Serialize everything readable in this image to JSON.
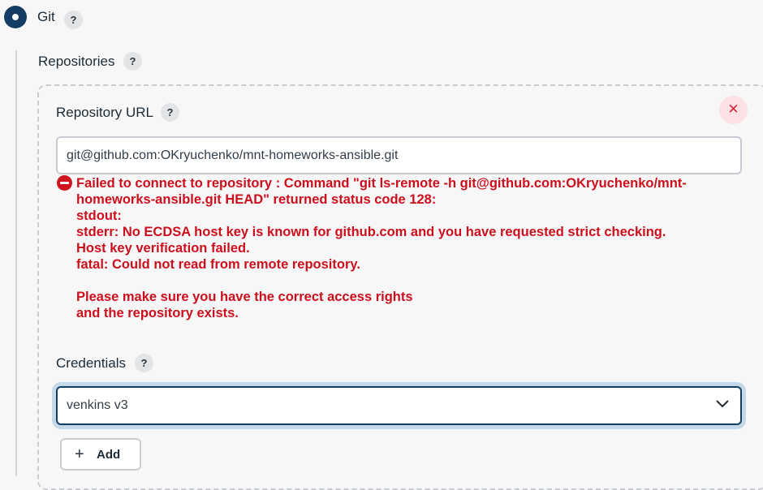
{
  "scm": {
    "option_label": "Git",
    "help_glyph": "?"
  },
  "repositories": {
    "label": "Repositories",
    "url_label": "Repository URL",
    "url_value": "git@github.com:OKryuchenko/mnt-homeworks-ansible.git",
    "delete_glyph": "✕",
    "error": {
      "lines": [
        "Failed to connect to repository : Command \"git ls-remote -h git@github.com:OKryuchenko/mnt-",
        "homeworks-ansible.git HEAD\" returned status code 128:",
        "stdout:",
        "stderr: No ECDSA host key is known for github.com and you have requested strict checking.",
        "Host key verification failed.",
        "fatal: Could not read from remote repository.",
        "",
        "Please make sure you have the correct access rights",
        "and the repository exists."
      ],
      "color": "#cc0f1c"
    },
    "credentials_label": "Credentials",
    "credentials_selected": "venkins v3",
    "add_button": {
      "plus": "+",
      "label": "Add"
    }
  },
  "colors": {
    "accent": "#133d63",
    "error": "#cc0f1c",
    "delete": "#d2283a",
    "background": "#f7f7f8"
  },
  "icons": {
    "radio": "radio-selected-icon",
    "help": "help-icon",
    "delete": "close-icon",
    "error": "error-icon",
    "dropdown": "chevron-down-icon",
    "add": "plus-icon"
  }
}
